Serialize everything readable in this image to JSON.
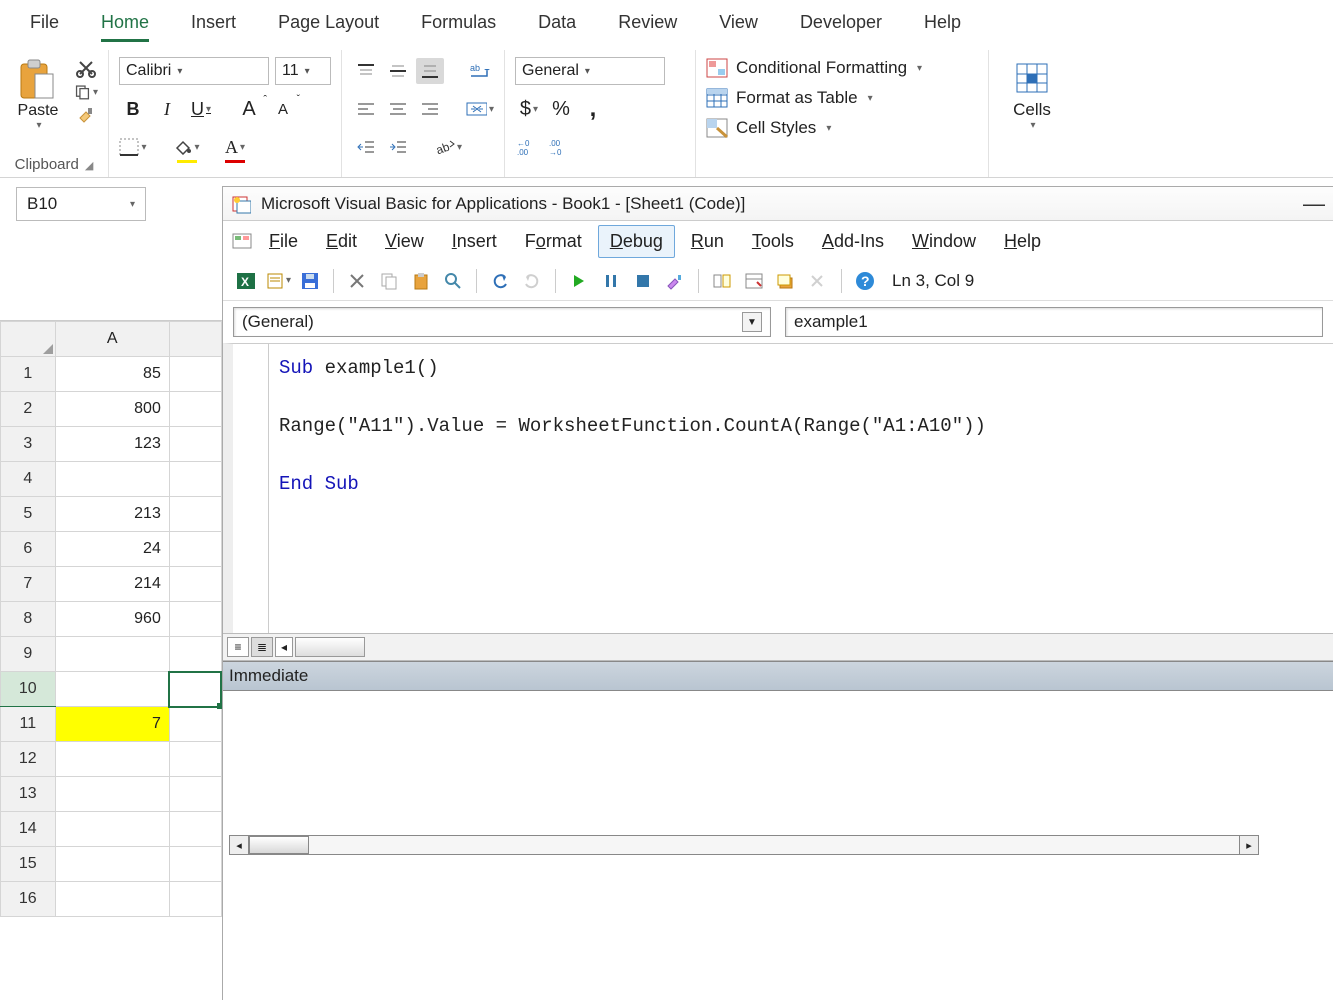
{
  "ribbon": {
    "tabs": [
      "File",
      "Home",
      "Insert",
      "Page Layout",
      "Formulas",
      "Data",
      "Review",
      "View",
      "Developer",
      "Help"
    ],
    "active": "Home",
    "clipboard": {
      "paste": "Paste",
      "label": "Clipboard"
    },
    "font": {
      "name": "Calibri",
      "size": "11",
      "bold": "B",
      "italic": "I",
      "underline": "U",
      "grow": "A",
      "shrink": "A"
    },
    "number": {
      "format": "General",
      "cur": "$",
      "pct": "%",
      "comma": ",",
      "inc": "",
      "dec": ""
    },
    "styles": {
      "cond": "Conditional Formatting",
      "table": "Format as Table",
      "cell": "Cell Styles"
    },
    "cells": {
      "label": "Cells"
    }
  },
  "namebox": "B10",
  "grid": {
    "col": "A",
    "rows": [
      {
        "n": "1",
        "v": "85"
      },
      {
        "n": "2",
        "v": "800"
      },
      {
        "n": "3",
        "v": "123"
      },
      {
        "n": "4",
        "v": ""
      },
      {
        "n": "5",
        "v": "213"
      },
      {
        "n": "6",
        "v": "24"
      },
      {
        "n": "7",
        "v": "214"
      },
      {
        "n": "8",
        "v": "960"
      },
      {
        "n": "9",
        "v": ""
      },
      {
        "n": "10",
        "v": ""
      },
      {
        "n": "11",
        "v": "7"
      },
      {
        "n": "12",
        "v": ""
      },
      {
        "n": "13",
        "v": ""
      },
      {
        "n": "14",
        "v": ""
      },
      {
        "n": "15",
        "v": ""
      },
      {
        "n": "16",
        "v": ""
      }
    ]
  },
  "vbe": {
    "title": "Microsoft Visual Basic for Applications - Book1 - [Sheet1 (Code)]",
    "menus": [
      "File",
      "Edit",
      "View",
      "Insert",
      "Format",
      "Debug",
      "Run",
      "Tools",
      "Add-Ins",
      "Window",
      "Help"
    ],
    "activeMenu": "Debug",
    "status": "Ln 3, Col 9",
    "objectSel": "(General)",
    "procSel": "example1",
    "code": {
      "l1a": "Sub",
      "l1b": " example1()",
      "l2": "Range(\"A11\").Value = WorksheetFunction.CountA(Range(\"A1:A10\"))",
      "l3a": "End",
      "l3b": " Sub"
    },
    "immediate": "Immediate"
  }
}
